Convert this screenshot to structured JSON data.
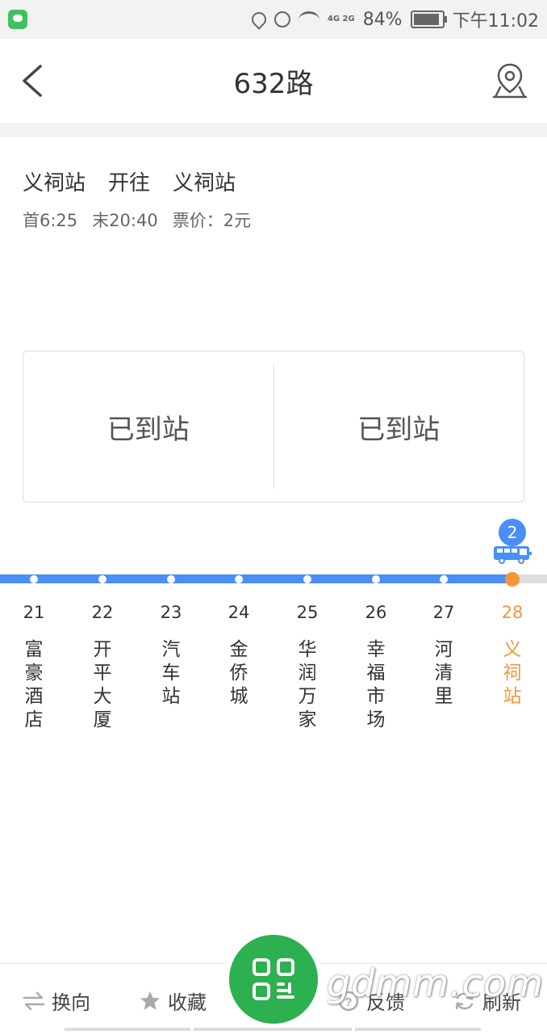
{
  "status_bar": {
    "battery": "84%",
    "time": "下午11:02",
    "network_label": "4G 2G"
  },
  "header": {
    "title": "632路"
  },
  "route": {
    "from": "义祠站",
    "direction": "开往",
    "to": "义祠站",
    "first_bus": "首6:25",
    "last_bus": "末20:40",
    "fare": "票价：2元"
  },
  "arrival": {
    "left_status": "已到站",
    "right_status": "已到站"
  },
  "bus_badge": {
    "count": "2"
  },
  "stops": [
    {
      "num": "21",
      "name": "富豪酒店"
    },
    {
      "num": "22",
      "name": "开平大厦"
    },
    {
      "num": "23",
      "name": "汽车站"
    },
    {
      "num": "24",
      "name": "金侨城"
    },
    {
      "num": "25",
      "name": "华润万家"
    },
    {
      "num": "26",
      "name": "幸福市场"
    },
    {
      "num": "27",
      "name": "河清里"
    },
    {
      "num": "28",
      "name": "义祠站"
    }
  ],
  "toolbar": {
    "reverse_label": "换向",
    "favorite_label": "收藏",
    "feedback_label": "反馈",
    "refresh_label": "刷新"
  },
  "watermark": "gdmm.com",
  "colors": {
    "accent_blue": "#4a8ff5",
    "current_orange": "#f5963a",
    "scan_green": "#2db04f"
  }
}
